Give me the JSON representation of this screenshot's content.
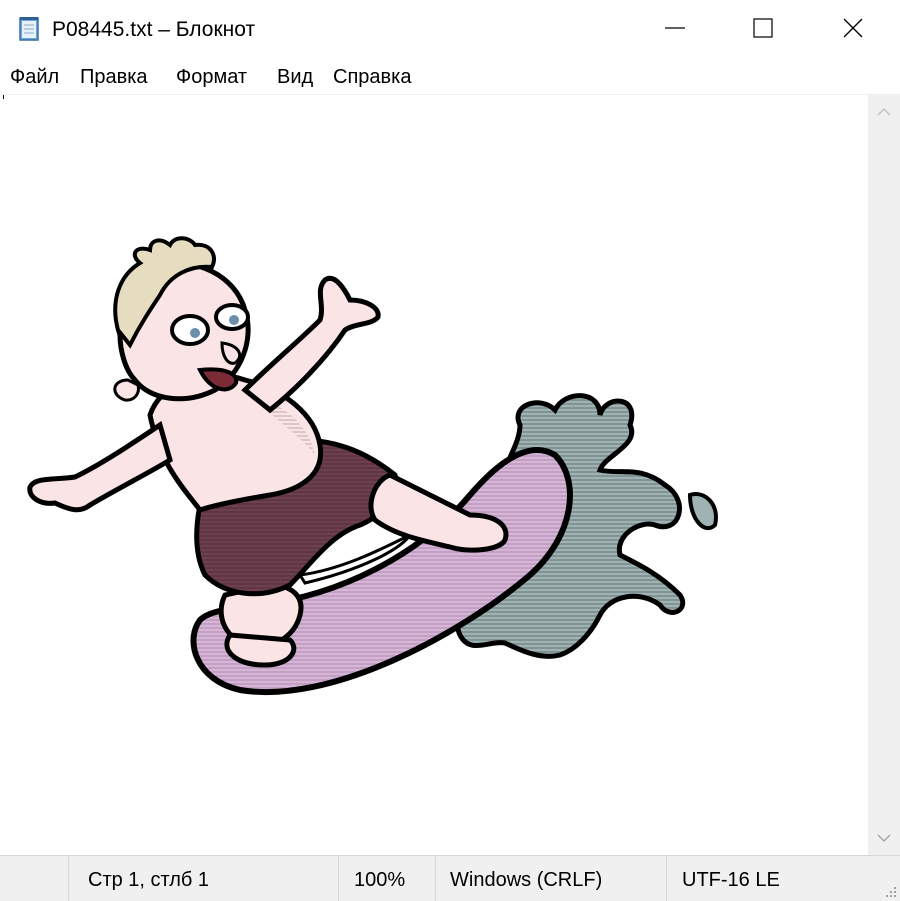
{
  "window": {
    "title": "P08445.txt – Блокнот"
  },
  "menu": {
    "items": [
      "Файл",
      "Правка",
      "Формат",
      "Вид",
      "Справка"
    ]
  },
  "status": {
    "position": "Стр 1, стлб 1",
    "zoom": "100%",
    "line_endings": "Windows (CRLF)",
    "encoding": "UTF-16 LE"
  },
  "icons": {
    "app": "notepad-icon",
    "minimize": "minimize-icon",
    "maximize": "maximize-icon",
    "close": "close-icon",
    "scroll_up": "chevron-up-icon",
    "scroll_down": "chevron-down-icon",
    "grip": "resize-grip-icon"
  },
  "colors": {
    "skin": "#fbe4e6",
    "shorts": "#6e3f4f",
    "surfboard": "#d7b4d8",
    "water": "#9fb3b5",
    "hair": "#e6dcc0",
    "chrome": "#f0f0f0"
  }
}
